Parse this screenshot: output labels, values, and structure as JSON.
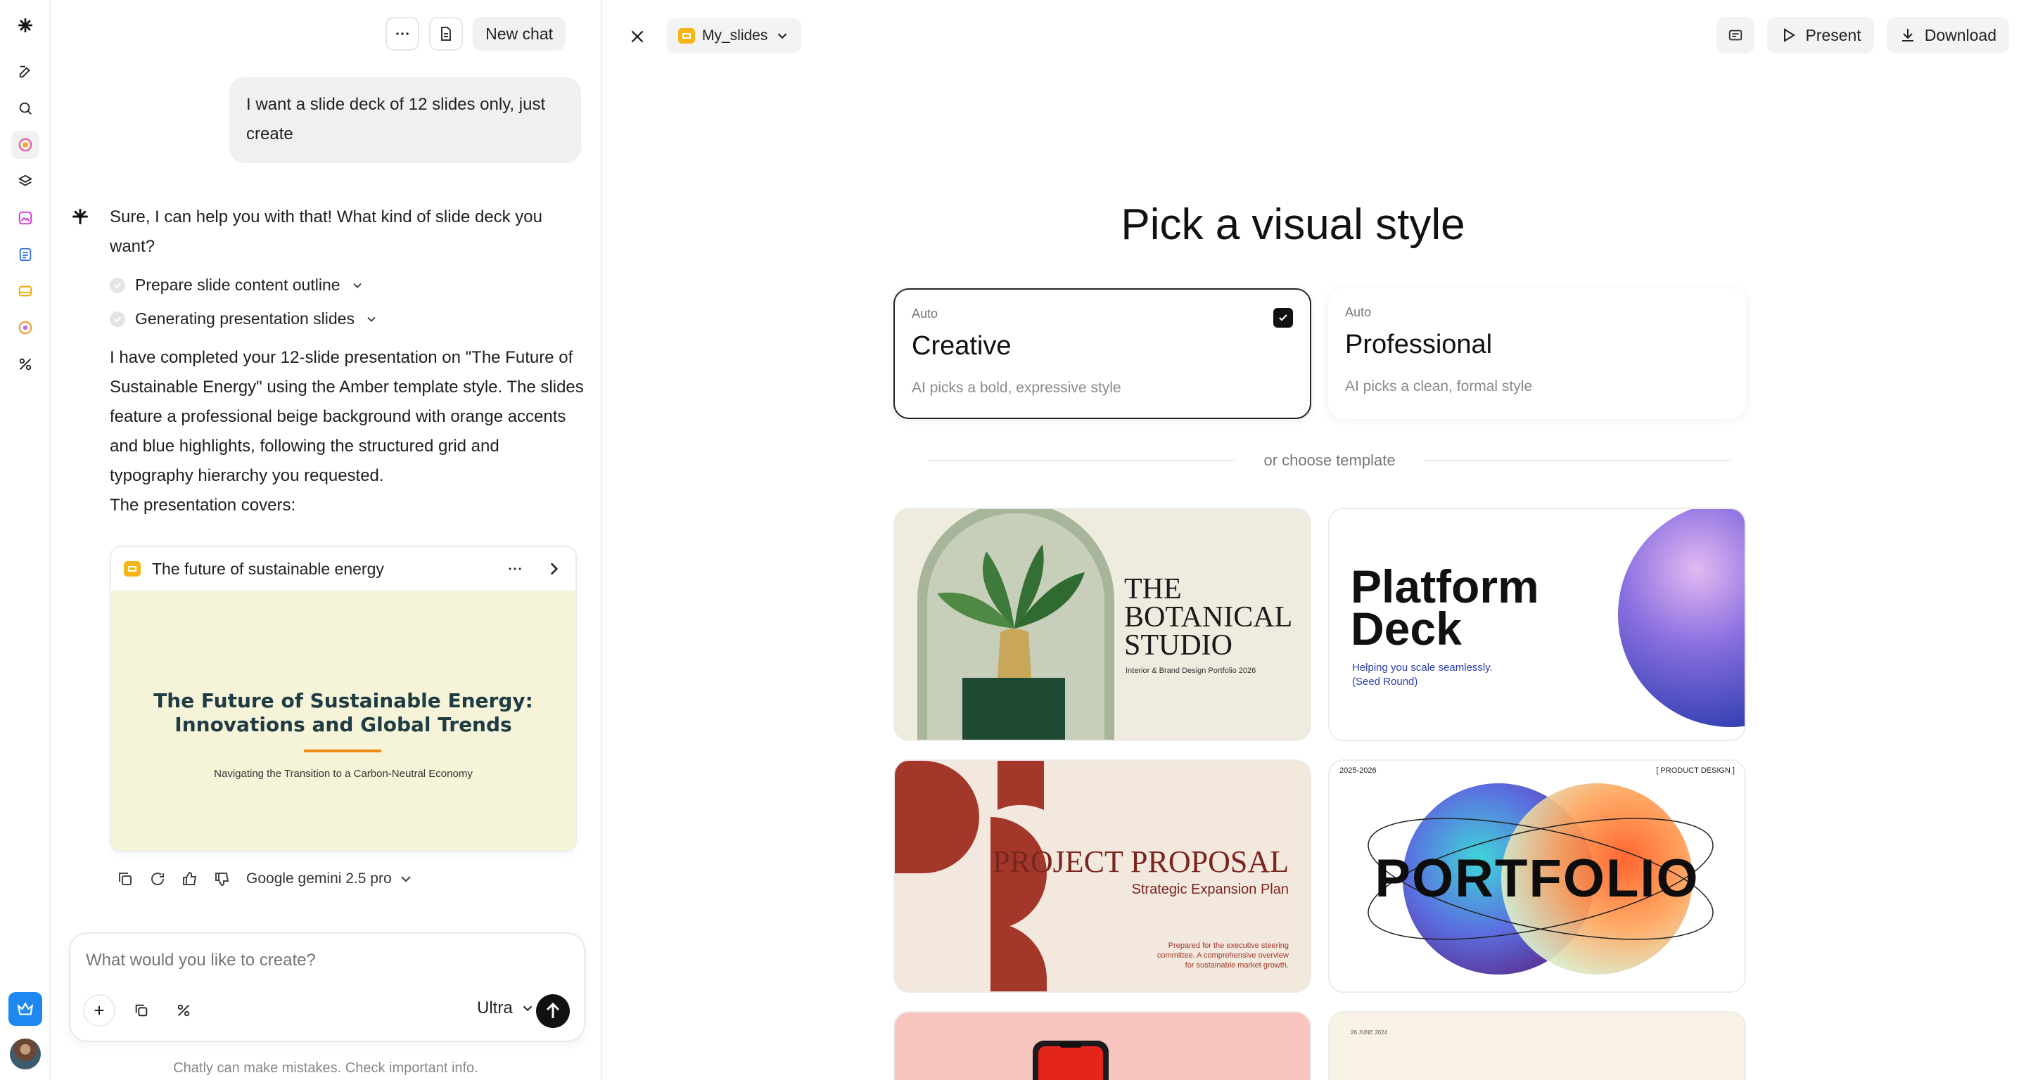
{
  "rail": {
    "icons": [
      "logo-icon",
      "edit-icon",
      "search-icon",
      "agents-icon",
      "layers-icon",
      "image-icon",
      "docs-icon",
      "slides-icon",
      "palette-icon",
      "tools-icon"
    ]
  },
  "chat": {
    "new_chat_label": "New chat",
    "user_message": "I want a slide deck of 12 slides only, just create",
    "bot_intro": "Sure, I can help you with that! What kind of slide deck you want?",
    "steps": [
      {
        "label": "Prepare slide content outline"
      },
      {
        "label": "Generating presentation slides"
      }
    ],
    "bot_result": "I have completed your 12-slide presentation on \"The Future of Sustainable Energy\" using the Amber template style. The slides feature a professional beige background with orange accents and blue highlights, following the structured grid and typography hierarchy you requested.",
    "bot_covers": "The presentation covers:",
    "presentation": {
      "title": "The future of sustainable energy",
      "slide_title_line1": "The Future of Sustainable Energy:",
      "slide_title_line2": "Innovations and Global Trends",
      "slide_subtitle": "Navigating the Transition to a Carbon-Neutral Economy"
    },
    "model_label": "Google gemini 2.5 pro",
    "composer_placeholder": "What would you like to create?",
    "mode_label": "Ultra",
    "disclaimer": "Chatly can make mistakes. Check important info."
  },
  "main": {
    "file_name": "My_slides",
    "present_label": "Present",
    "download_label": "Download",
    "heading": "Pick a visual style",
    "styles": [
      {
        "caption": "Auto",
        "name": "Creative",
        "desc": "AI picks a bold, expressive style",
        "selected": true
      },
      {
        "caption": "Auto",
        "name": "Professional",
        "desc": "AI picks a clean, formal style",
        "selected": false
      }
    ],
    "divider_label": "or choose template",
    "templates": {
      "botanical": {
        "line1": "THE",
        "line2": "BOTANICAL",
        "line3": "STUDIO",
        "sub": "Interior & Brand Design Portfolio 2026"
      },
      "platform": {
        "line1": "Platform",
        "line2": "Deck",
        "sub1": "Helping you scale seamlessly.",
        "sub2": "(Seed Round)"
      },
      "proposal": {
        "title": "PROJECT PROPOSAL",
        "sub": "Strategic Expansion Plan",
        "note1": "Prepared for the executive steering",
        "note2": "committee. A comprehensive overview",
        "note3": "for sustainable market growth."
      },
      "portfolio": {
        "title": "PORTFOLIO",
        "years": "2025-2026",
        "tag": "[ PRODUCT DESIGN ]"
      },
      "fifth": {},
      "sixth": {
        "date": "26 JUNE 2024"
      }
    }
  },
  "colors": {
    "accent_blue": "#1e88f0",
    "slides_yellow": "#f6b517",
    "slide_bg": "#f5f3d8",
    "slide_accent_orange": "#ef8a17",
    "proposal_red": "#a3382a"
  }
}
